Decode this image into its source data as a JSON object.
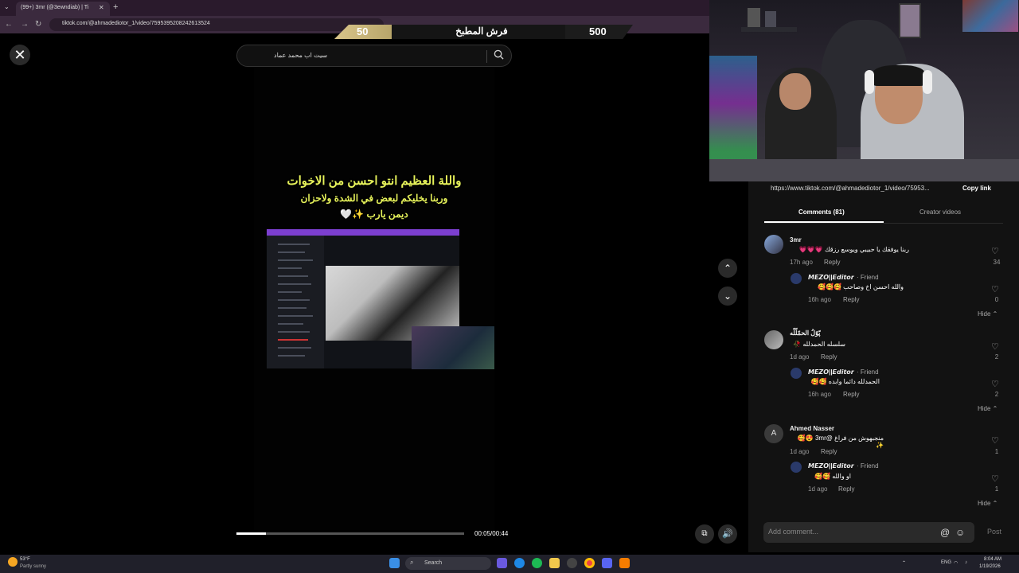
{
  "browser": {
    "tab_title": "(99+) 3mr (@3ewndiab) | Ti",
    "url": "tiktok.com/@ahmadediotor_1/video/7595395208242613524"
  },
  "scoreboard": {
    "left_score": "50",
    "title": "فرش المطبخ",
    "right_score": "500"
  },
  "search": {
    "query": "سيت اب محمد عماد"
  },
  "video": {
    "caption_lines": [
      "واللة العظيم انتو احسن من الاخوات",
      "وربنا يخليكم لبعض في الشدة ولاحزان",
      "ديمن يارب ✨🤍"
    ],
    "progress": 0.13,
    "time": "00:05/00:44"
  },
  "share": {
    "url": "https://www.tiktok.com/@ahmadediotor_1/video/75953...",
    "copy_label": "Copy link"
  },
  "tabs": {
    "comments": "Comments (81)",
    "creator": "Creator videos"
  },
  "comments": [
    {
      "name": "3mr",
      "text": "ربنا يوفقك يا حبيبي ويوسع رزقك 💗💗💗",
      "time": "17h ago",
      "reply": "Reply",
      "likes": "34",
      "replies": [
        {
          "name": "𝙈𝙀𝙕𝙊||𝙀𝙙𝙞𝙩𝙤𝙧",
          "friend": "· Friend",
          "text": "والله احسن اخ وصاحب 🥰🥰🥰",
          "time": "16h ago",
          "reply": "Reply",
          "likes": "0"
        }
      ],
      "hide": "Hide ⌃"
    },
    {
      "name": "پّوٌلُ الحمّلّلّه",
      "text": "سلسله الحمدلله 🥀",
      "time": "1d ago",
      "reply": "Reply",
      "likes": "2",
      "replies": [
        {
          "name": "𝙈𝙀𝙕𝙊||𝙀𝙙𝙞𝙩𝙤𝙧",
          "friend": "· Friend",
          "text": "الحمدلله دائما وابده 🥰🥰",
          "time": "16h ago",
          "reply": "Reply",
          "likes": "2"
        }
      ],
      "hide": "Hide ⌃"
    },
    {
      "name": "Ahmed Nasser",
      "avatar_letter": "A",
      "text": "منجبهوش من فراغ @3mr 😍🥰✨",
      "time": "1d ago",
      "reply": "Reply",
      "likes": "1",
      "replies": [
        {
          "name": "𝙈𝙀𝙕𝙊||𝙀𝙙𝙞𝙩𝙤𝙧",
          "friend": "· Friend",
          "text": "او والله 🥰🥰",
          "time": "1d ago",
          "reply": "Reply",
          "likes": "1"
        }
      ],
      "hide": "Hide ⌃"
    }
  ],
  "composer": {
    "placeholder": "Add comment...",
    "post": "Post"
  },
  "taskbar": {
    "weather_temp": "53°F",
    "weather_desc": "Partly sunny",
    "search": "Search",
    "lang": "ENG",
    "time": "8:04 AM",
    "date": "1/19/2026"
  },
  "colors": {
    "accent_gold": "#d9c58a",
    "caption_yellow": "#e6f25a",
    "panel_bg": "#121212"
  }
}
